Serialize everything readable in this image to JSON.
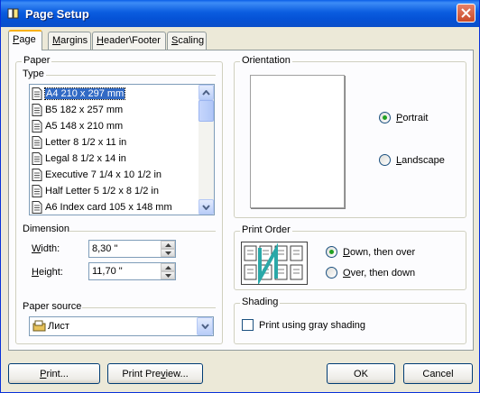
{
  "window": {
    "title": "Page Setup"
  },
  "tabs": [
    {
      "label": "Page",
      "underline": "P",
      "rest": "age"
    },
    {
      "label": "Margins",
      "underline": "M",
      "rest": "argins"
    },
    {
      "label": "Header\\Footer",
      "underline": "H",
      "rest": "eader\\Footer"
    },
    {
      "label": "Scaling",
      "underline": "S",
      "rest": "caling"
    }
  ],
  "paper": {
    "group_label": "Paper",
    "type_label": "Type",
    "types": [
      "A4 210 x 297 mm",
      "B5 182 x 257 mm",
      "A5 148 x 210 mm",
      "Letter 8 1/2 x 11 in",
      "Legal 8 1/2 x 14 in",
      "Executive 7 1/4 x 10 1/2 in",
      "Half Letter 5 1/2 x 8 1/2 in",
      "A6 Index card 105 x 148 mm"
    ],
    "selected_type": "A4 210 x 297 mm",
    "dimension_label": "Dimension",
    "width_label_u": "W",
    "width_label_rest": "idth:",
    "width_value": "8,30 \"",
    "height_label_u": "H",
    "height_label_rest": "eight:",
    "height_value": "11,70 \"",
    "source_label": "Paper source",
    "source_value": "Лист"
  },
  "orientation": {
    "group_label": "Orientation",
    "portrait_u": "P",
    "portrait_rest": "ortrait",
    "landscape_u": "L",
    "landscape_rest": "andscape",
    "selected": "Portrait"
  },
  "print_order": {
    "group_label": "Print Order",
    "down_then_over_u": "D",
    "down_then_over_rest": "own, then over",
    "over_then_down_u": "O",
    "over_then_down_rest": "ver, then down",
    "selected": "Down, then over"
  },
  "shading": {
    "group_label": "Shading",
    "checkbox_label_pre": "Print using ",
    "checkbox_label_u": "g",
    "checkbox_label_post": "ray shading",
    "checked": false
  },
  "buttons": {
    "print_u": "P",
    "print_rest": "rint...",
    "preview_pre": "Print Pre",
    "preview_u": "v",
    "preview_post": "iew...",
    "ok": "OK",
    "cancel": "Cancel"
  },
  "colors": {
    "title_bar": "#0a5fe8",
    "selection": "#316ac5",
    "dialog_bg": "#ece9d8",
    "radio_dot": "#21a121"
  }
}
